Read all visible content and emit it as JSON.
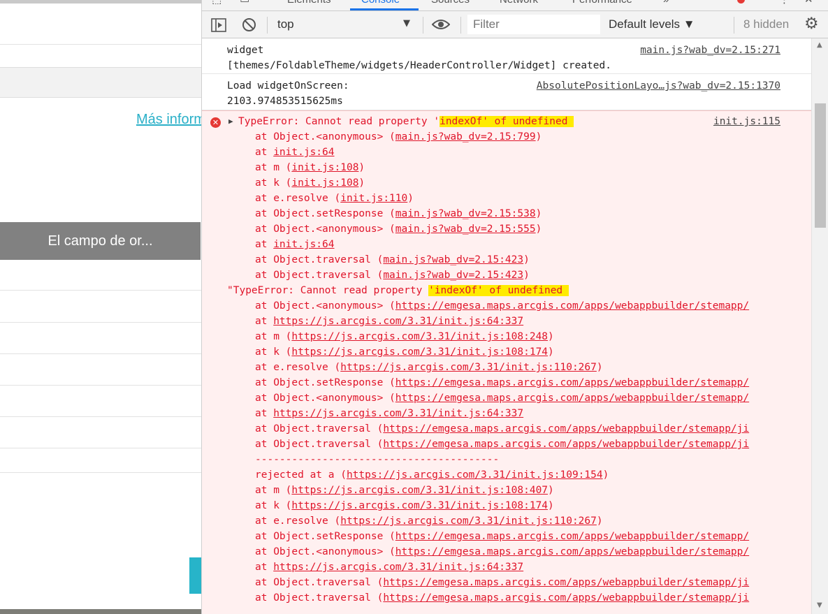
{
  "left_page": {
    "link_text": "Más inform",
    "field_button": "El campo de or..."
  },
  "devtools": {
    "tabs": [
      "Elements",
      "Console",
      "Sources",
      "Network",
      "Performance"
    ],
    "active_tab": "Console",
    "toolbar": {
      "context": "top",
      "filter_placeholder": "Filter",
      "levels": "Default levels ▼",
      "hidden_count": "8 hidden"
    },
    "messages": [
      {
        "line1": "widget",
        "line2": "[themes/FoldableTheme/widgets/HeaderController/Widget] created.",
        "source": "main.js?wab_dv=2.15:271"
      },
      {
        "line1": "Load widgetOnScreen:",
        "line2": "2103.974853515625ms",
        "source": "AbsolutePositionLayo…js?wab_dv=2.15:1370"
      }
    ],
    "error": {
      "prefix": "TypeError: Cannot read property '",
      "highlight": "indexOf' of undefined ",
      "source": "init.js:115",
      "stack1": [
        [
          "at Object.<anonymous> (",
          "main.js?wab_dv=2.15:799",
          ")"
        ],
        [
          "at ",
          "init.js:64",
          ""
        ],
        [
          "at m (",
          "init.js:108",
          ")"
        ],
        [
          "at k (",
          "init.js:108",
          ")"
        ],
        [
          "at e.resolve (",
          "init.js:110",
          ")"
        ],
        [
          "at Object.setResponse (",
          "main.js?wab_dv=2.15:538",
          ")"
        ],
        [
          "at Object.<anonymous> (",
          "main.js?wab_dv=2.15:555",
          ")"
        ],
        [
          "at ",
          "init.js:64",
          ""
        ],
        [
          "at Object.traversal (",
          "main.js?wab_dv=2.15:423",
          ")"
        ],
        [
          "at Object.traversal (",
          "main.js?wab_dv=2.15:423",
          ")"
        ]
      ],
      "string_prefix": "\"TypeError: Cannot read property ",
      "string_highlight": "'indexOf' of undefined ",
      "stack2": [
        [
          "at Object.<anonymous> (",
          "https://emgesa.maps.arcgis.com/apps/webappbuilder/stemapp/"
        ],
        [
          "at ",
          "https://js.arcgis.com/3.31/init.js:64:337"
        ],
        [
          "at m (",
          "https://js.arcgis.com/3.31/init.js:108:248",
          ")"
        ],
        [
          "at k (",
          "https://js.arcgis.com/3.31/init.js:108:174",
          ")"
        ],
        [
          "at e.resolve (",
          "https://js.arcgis.com/3.31/init.js:110:267",
          ")"
        ],
        [
          "at Object.setResponse (",
          "https://emgesa.maps.arcgis.com/apps/webappbuilder/stemapp/"
        ],
        [
          "at Object.<anonymous> (",
          "https://emgesa.maps.arcgis.com/apps/webappbuilder/stemapp/"
        ],
        [
          "at ",
          "https://js.arcgis.com/3.31/init.js:64:337"
        ],
        [
          "at Object.traversal (",
          "https://emgesa.maps.arcgis.com/apps/webappbuilder/stemapp/ji"
        ],
        [
          "at Object.traversal (",
          "https://emgesa.maps.arcgis.com/apps/webappbuilder/stemapp/ji"
        ]
      ],
      "divider": "----------------------------------------",
      "stack3": [
        [
          "rejected at a (",
          "https://js.arcgis.com/3.31/init.js:109:154",
          ")"
        ],
        [
          "at m (",
          "https://js.arcgis.com/3.31/init.js:108:407",
          ")"
        ],
        [
          "at k (",
          "https://js.arcgis.com/3.31/init.js:108:174",
          ")"
        ],
        [
          "at e.resolve (",
          "https://js.arcgis.com/3.31/init.js:110:267",
          ")"
        ],
        [
          "at Object.setResponse (",
          "https://emgesa.maps.arcgis.com/apps/webappbuilder/stemapp/"
        ],
        [
          "at Object.<anonymous> (",
          "https://emgesa.maps.arcgis.com/apps/webappbuilder/stemapp/"
        ],
        [
          "at ",
          "https://js.arcgis.com/3.31/init.js:64:337"
        ],
        [
          "at Object.traversal (",
          "https://emgesa.maps.arcgis.com/apps/webappbuilder/stemapp/ji"
        ],
        [
          "at Object.traversal (",
          "https://emgesa.maps.arcgis.com/apps/webappbuilder/stemapp/ji"
        ]
      ]
    }
  }
}
